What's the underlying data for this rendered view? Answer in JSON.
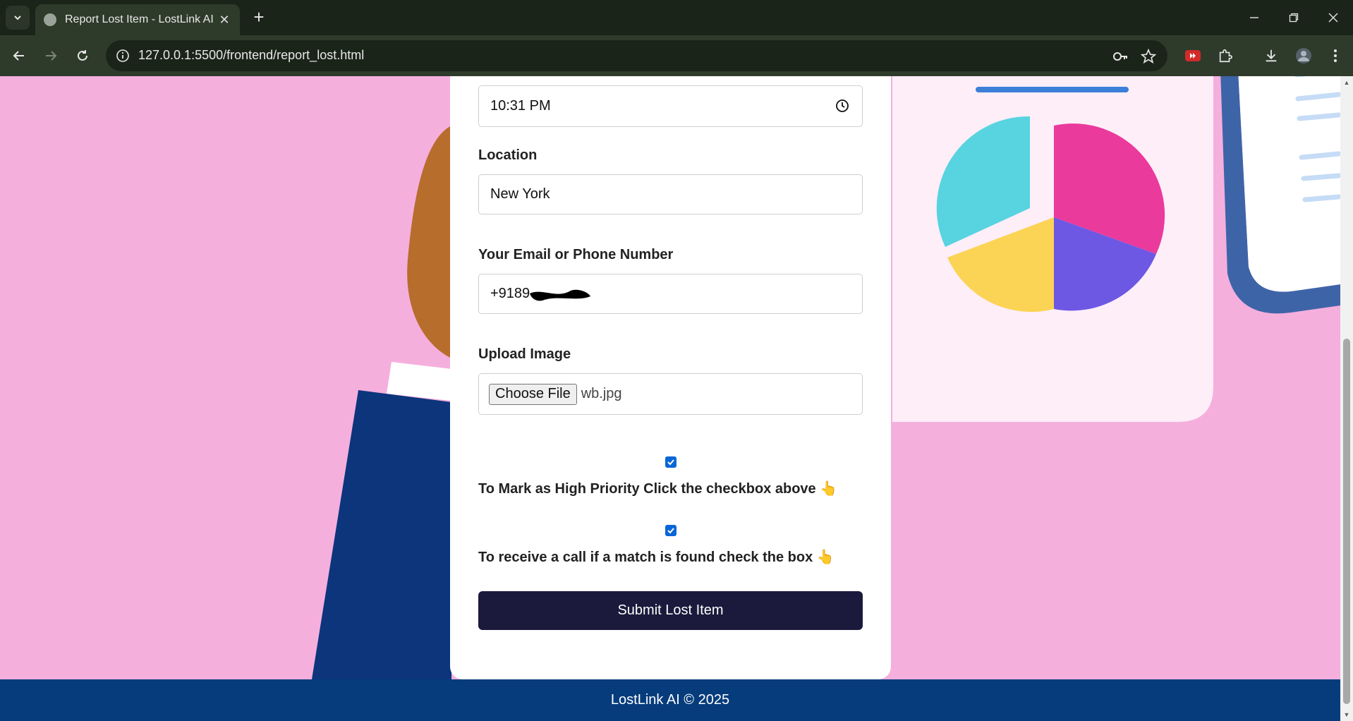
{
  "browser": {
    "tab_title": "Report Lost Item - LostLink AI",
    "url": "127.0.0.1:5500/frontend/report_lost.html"
  },
  "form": {
    "time_value": "10:31  PM",
    "location_label": "Location",
    "location_value": "New York",
    "contact_label": "Your Email or Phone Number",
    "contact_value": "+9189",
    "upload_label": "Upload Image",
    "choose_file_label": "Choose File",
    "file_name": "wb.jpg",
    "high_priority_checked": true,
    "high_priority_text": "To Mark as High Priority Click the checkbox above 👆",
    "call_checked": true,
    "call_text": "To receive a call if a match is found check the box 👆",
    "submit_label": "Submit Lost Item"
  },
  "footer": {
    "text": "LostLink AI © 2025"
  },
  "colors": {
    "page_bg": "#f5afdd",
    "submit_bg": "#1b1a3c",
    "footer_bg": "#063c7c",
    "checkbox": "#0a66d8"
  }
}
